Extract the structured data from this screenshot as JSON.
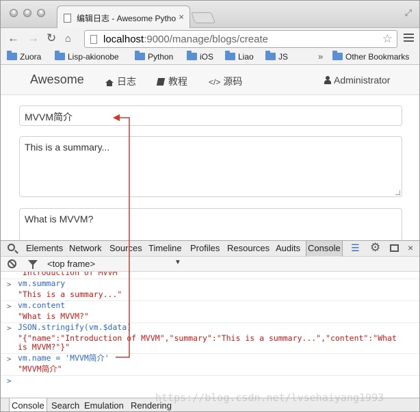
{
  "browser": {
    "tab_title": "编辑日志 - Awesome Pytho",
    "tab_close": "×",
    "url_host": "localhost",
    "url_path": ":9000/manage/blogs/create",
    "bookmarks": [
      "Zuora",
      "Lisp-akionobe",
      "Python",
      "iOS",
      "Liao",
      "JS"
    ],
    "bookmarks_more": "»",
    "other_bookmarks": "Other Bookmarks"
  },
  "site": {
    "brand": "Awesome",
    "nav": [
      "日志",
      "教程",
      "源码"
    ],
    "source_code_glyph": "</>",
    "user": "Administrator"
  },
  "form": {
    "name_value": "MVVM简介",
    "summary_value": "This is a summary...",
    "content_value": "What is MVVM?"
  },
  "devtools": {
    "tabs": [
      "Elements",
      "Network",
      "Sources",
      "Timeline",
      "Profiles",
      "Resources",
      "Audits",
      "Console"
    ],
    "active_tab": "Console",
    "frame_select": "<top frame>",
    "console_lines": [
      {
        "kind": "out",
        "text": "\"Introduction of MVVM\""
      },
      {
        "kind": "in",
        "text": "vm.summary"
      },
      {
        "kind": "out",
        "text": "\"This is a summary...\""
      },
      {
        "kind": "in",
        "text": "vm.content"
      },
      {
        "kind": "out",
        "text": "\"What is MVVM?\""
      },
      {
        "kind": "in",
        "text": "JSON.stringify(vm.$data)"
      },
      {
        "kind": "out",
        "text": "\"{\"name\":\"Introduction of MVVM\",\"summary\":\"This is a summary...\",\"content\":\"What"
      },
      {
        "kind": "out",
        "text": "is MVVM?\"}\""
      },
      {
        "kind": "in",
        "text": "vm.name = 'MVVM简介'"
      },
      {
        "kind": "out",
        "text": "\"MVVM简介\""
      }
    ],
    "drawer_tabs": [
      "Console",
      "Search",
      "Emulation",
      "Rendering"
    ]
  },
  "watermark": "https://blog.csdn.net/lvsehaiyang1993",
  "colors": {
    "annotation_arrow": "#d0392b",
    "console_input": "#2e66c8",
    "console_output": "#c41a16"
  }
}
